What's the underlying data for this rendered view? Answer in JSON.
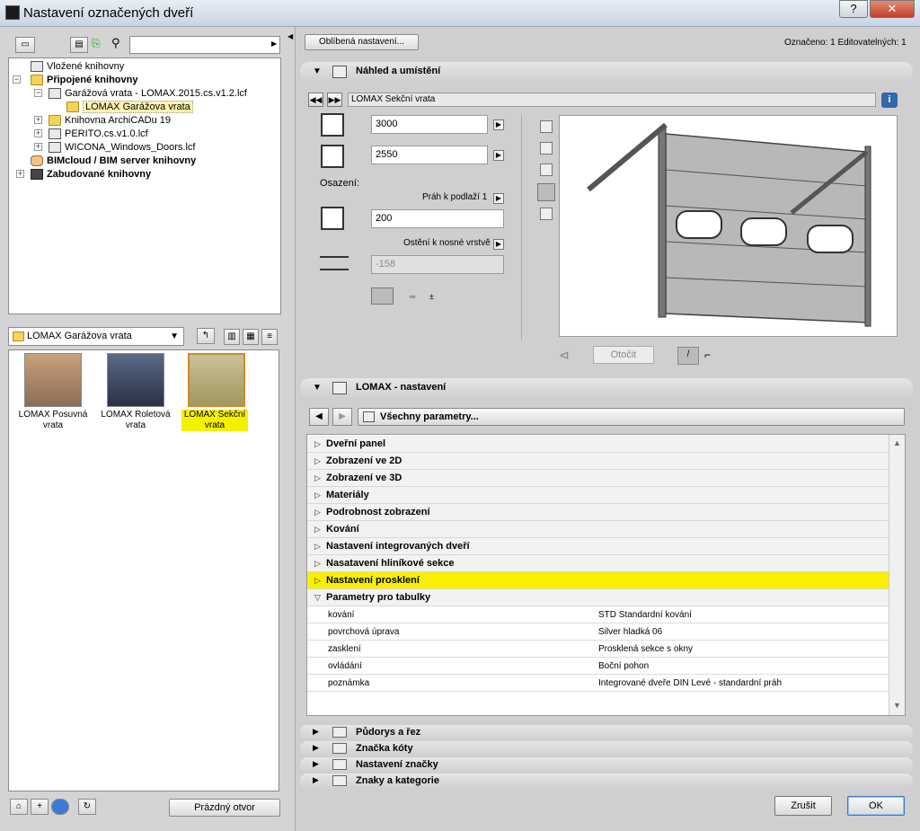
{
  "window": {
    "title": "Nastavení označených dveří",
    "help": "?",
    "close": "✕"
  },
  "library_tree": [
    {
      "label": "Vložené knihovny",
      "bold": false,
      "icon": "lib"
    },
    {
      "label": "Připojené knihovny",
      "bold": true,
      "icon": "folder"
    },
    {
      "label": "Garážová vrata - LOMAX.2015.cs.v1.2.lcf",
      "bold": false,
      "icon": "lib"
    },
    {
      "label": "LOMAX Garážova vrata",
      "bold": false,
      "icon": "folder"
    },
    {
      "label": "Knihovna ArchiCADu 19",
      "bold": false,
      "icon": "folder"
    },
    {
      "label": "PERITO.cs.v1.0.lcf",
      "bold": false,
      "icon": "lib"
    },
    {
      "label": "WICONA_Windows_Doors.lcf",
      "bold": false,
      "icon": "lib"
    },
    {
      "label": "BIMcloud / BIM server knihovny",
      "bold": true,
      "icon": "cloud"
    },
    {
      "label": "Zabudované knihovny",
      "bold": true,
      "icon": "box"
    }
  ],
  "folder_dropdown": "LOMAX Garážova vrata",
  "gallery": [
    {
      "label": "LOMAX Posuvná vrata",
      "selected": false
    },
    {
      "label": "LOMAX Roletová vrata",
      "selected": false
    },
    {
      "label": "LOMAX Sekční vrata",
      "selected": true
    }
  ],
  "empty_opening_button": "Prázdný otvor",
  "favorites_button": "Oblíbená nastavení...",
  "selection_info": "Označeno: 1 Editovatelných: 1",
  "preview_section": {
    "title": "Náhled a umístění",
    "object_name": "LOMAX Sekční vrata",
    "width": "3000",
    "height": "2550",
    "placement_label": "Osazení:",
    "sill_ref": "Práh k podlaží 1",
    "sill_value": "200",
    "reveal_ref": "Ostění k nosné vrstvě",
    "reveal_value": "-158",
    "rotate_button": "Otočit"
  },
  "settings_section": {
    "title": "LOMAX - nastavení",
    "all_params": "Všechny parametry...",
    "groups": [
      {
        "label": "Dveřní panel",
        "expanded": false
      },
      {
        "label": "Zobrazení ve 2D",
        "expanded": false
      },
      {
        "label": "Zobrazení ve 3D",
        "expanded": false
      },
      {
        "label": "Materiály",
        "expanded": false
      },
      {
        "label": "Podrobnost zobrazení",
        "expanded": false
      },
      {
        "label": "Kování",
        "expanded": false
      },
      {
        "label": "Nastavení integrovaných dveří",
        "expanded": false
      },
      {
        "label": "Nasatavení hliníkové sekce",
        "expanded": false
      },
      {
        "label": "Nastavení prosklení",
        "expanded": false,
        "highlight": true
      },
      {
        "label": "Parametry pro tabulky",
        "expanded": true
      }
    ],
    "table_params": [
      {
        "key": "kování",
        "value": "STD Standardní kování"
      },
      {
        "key": "povrchová úprava",
        "value": "Silver hladká 06"
      },
      {
        "key": "zasklení",
        "value": "Prosklená sekce s okny"
      },
      {
        "key": "ovládání",
        "value": "Boční pohon"
      },
      {
        "key": "poznámka",
        "value": "Integrované dveře DIN Levé - standardní práh"
      }
    ]
  },
  "collapsed_sections": [
    {
      "label": "Půdorys a řez"
    },
    {
      "label": "Značka kóty"
    },
    {
      "label": "Nastavení značky"
    },
    {
      "label": "Znaky a kategorie"
    }
  ],
  "buttons": {
    "cancel": "Zrušit",
    "ok": "OK"
  }
}
